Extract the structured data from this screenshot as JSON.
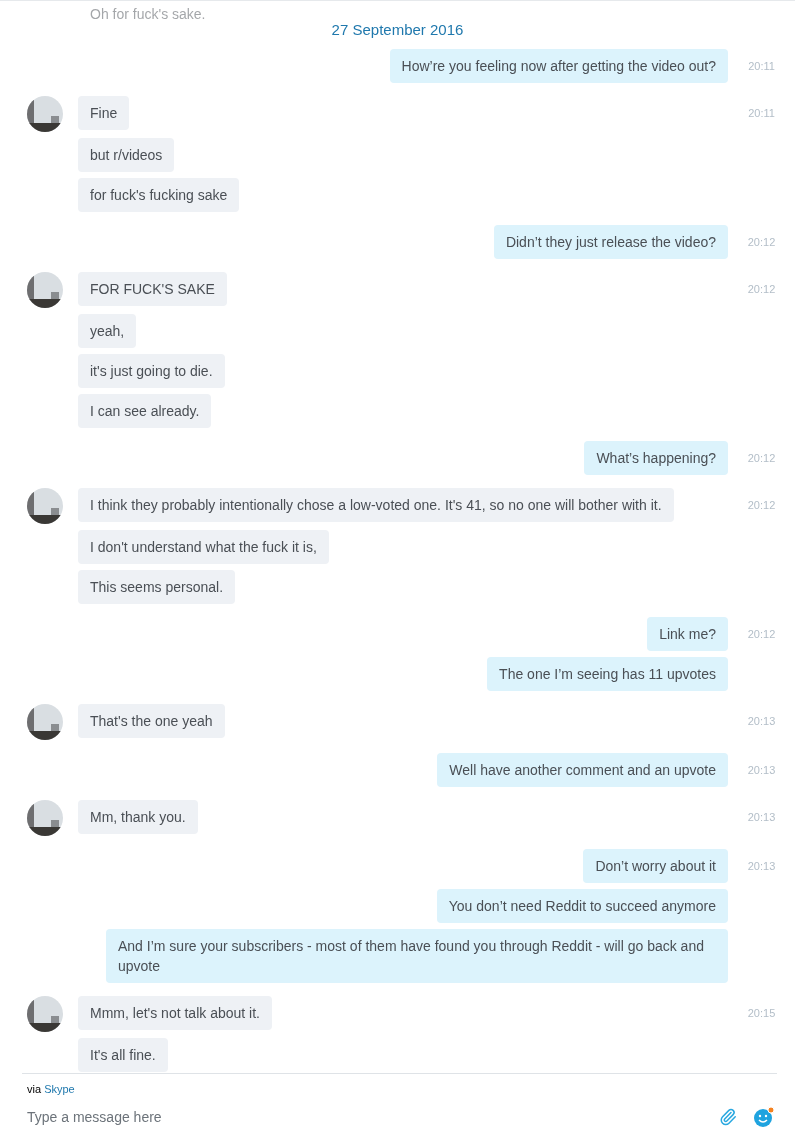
{
  "cut_message": "Oh for fuck's sake.",
  "date": "27 September 2016",
  "groups": [
    {
      "kind": "sent",
      "time": "20:11",
      "messages": [
        "How’re you feeling now after getting the video out?"
      ]
    },
    {
      "kind": "received",
      "time": "20:11",
      "messages": [
        "Fine",
        "but r/videos",
        "for fuck's fucking sake"
      ]
    },
    {
      "kind": "sent",
      "time": "20:12",
      "messages": [
        "Didn’t they just release the video?"
      ]
    },
    {
      "kind": "received",
      "time": "20:12",
      "messages": [
        "FOR FUCK'S SAKE",
        "yeah,",
        "it's just going to die.",
        "I can see already."
      ]
    },
    {
      "kind": "sent",
      "time": "20:12",
      "messages": [
        "What’s happening?"
      ]
    },
    {
      "kind": "received",
      "time": "20:12",
      "messages": [
        "I think they probably intentionally chose a low-voted one. It's 41, so no one will bother with it.",
        "I don't understand what the fuck it is,",
        "This seems personal."
      ]
    },
    {
      "kind": "sent",
      "time": "20:12",
      "messages": [
        "Link me?",
        "The one I’m seeing has 11 upvotes"
      ]
    },
    {
      "kind": "received",
      "time": "20:13",
      "messages": [
        "That's the one yeah"
      ]
    },
    {
      "kind": "sent",
      "time": "20:13",
      "messages": [
        "Well have another comment and an upvote"
      ]
    },
    {
      "kind": "received",
      "time": "20:13",
      "messages": [
        "Mm, thank you."
      ]
    },
    {
      "kind": "sent",
      "time": "20:13",
      "messages": [
        "Don’t worry about it",
        "You don’t need Reddit to succeed anymore",
        "And I’m sure your subscribers - most of them have found you through Reddit - will go back and upvote"
      ]
    },
    {
      "kind": "received",
      "time": "20:15",
      "messages": [
        "Mmm, let's not talk about it.",
        "It's all fine."
      ]
    }
  ],
  "footer": {
    "via": "via",
    "service": "Skype",
    "placeholder": "Type a message here"
  }
}
